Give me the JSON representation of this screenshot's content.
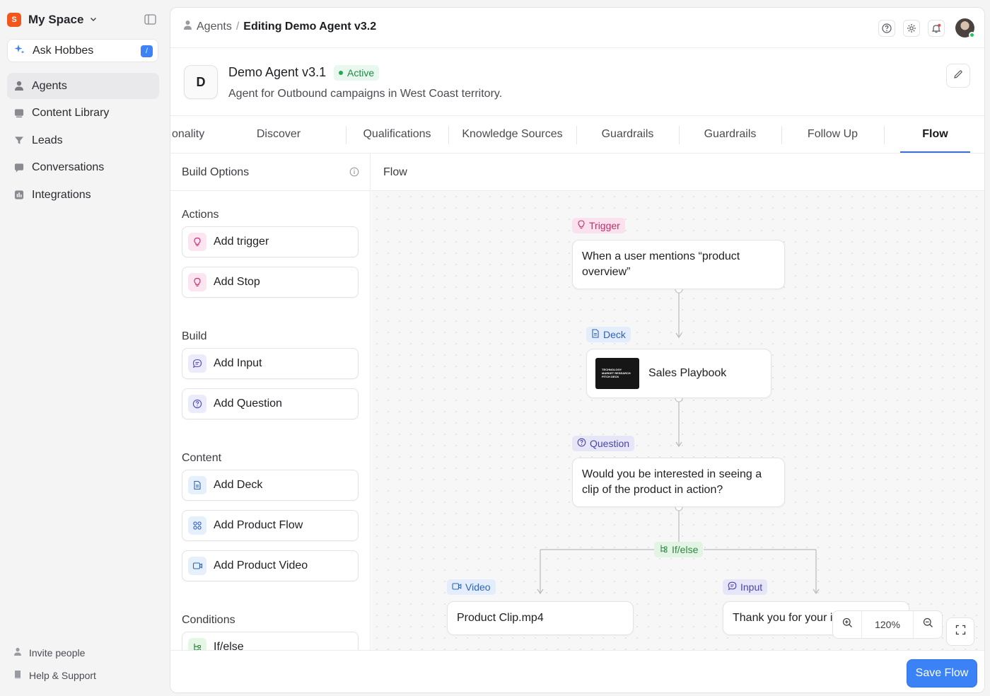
{
  "sidebar": {
    "space": {
      "logo_letter": "S",
      "name": "My Space"
    },
    "ask": {
      "label": "Ask Hobbes",
      "shortcut": "/"
    },
    "items": [
      {
        "label": "Agents",
        "icon": "person-icon",
        "active": true
      },
      {
        "label": "Content Library",
        "icon": "library-icon",
        "active": false
      },
      {
        "label": "Leads",
        "icon": "funnel-icon",
        "active": false
      },
      {
        "label": "Conversations",
        "icon": "chat-icon",
        "active": false
      },
      {
        "label": "Integrations",
        "icon": "chart-icon",
        "active": false
      }
    ],
    "footer": {
      "invite": "Invite people",
      "help": "Help & Support"
    }
  },
  "topbar": {
    "breadcrumb": {
      "parent": "Agents",
      "separator": "/",
      "current": "Editing Demo Agent v3.2"
    }
  },
  "agent": {
    "avatar_letter": "D",
    "name": "Demo Agent v3.1",
    "status": "Active",
    "description": "Agent for Outbound campaigns in West Coast territory."
  },
  "tabs": [
    "onality",
    "Discover",
    "Qualifications",
    "Knowledge Sources",
    "Guardrails",
    "Guardrails",
    "Follow Up",
    "Flow"
  ],
  "active_tab": "Flow",
  "build": {
    "title": "Build Options",
    "sections": {
      "actions": "Actions",
      "build": "Build",
      "content": "Content",
      "conditions": "Conditions"
    },
    "buttons": {
      "add_trigger": "Add trigger",
      "add_stop": "Add Stop",
      "add_input": "Add Input",
      "add_question": "Add Question",
      "add_deck": "Add Deck",
      "add_product_flow": "Add Product Flow",
      "add_product_video": "Add Product Video",
      "ifelse": "If/else"
    }
  },
  "canvas": {
    "title": "Flow",
    "nodes": {
      "trigger": {
        "tag": "Trigger",
        "line1": "When a user mentions “product",
        "line2": "overview”"
      },
      "deck": {
        "tag": "Deck",
        "text": "Sales Playbook",
        "thumb_l1": "TECHNOLOGY",
        "thumb_l2": "MARKET RESEARCH",
        "thumb_l3": "PITCH DECK"
      },
      "question": {
        "tag": "Question",
        "line1": "Would you be interested in seeing a",
        "line2": "clip of the product in action?"
      },
      "ifelse": {
        "tag": "If/else"
      },
      "video": {
        "tag": "Video",
        "text": "Product Clip.mp4"
      },
      "input": {
        "tag": "Input",
        "text": "Thank you for your i"
      }
    },
    "zoom": "120%"
  },
  "footer": {
    "save": "Save Flow"
  },
  "colors": {
    "accent": "#3b82f6",
    "active_green": "#22a853",
    "brand_orange": "#f2561d"
  }
}
